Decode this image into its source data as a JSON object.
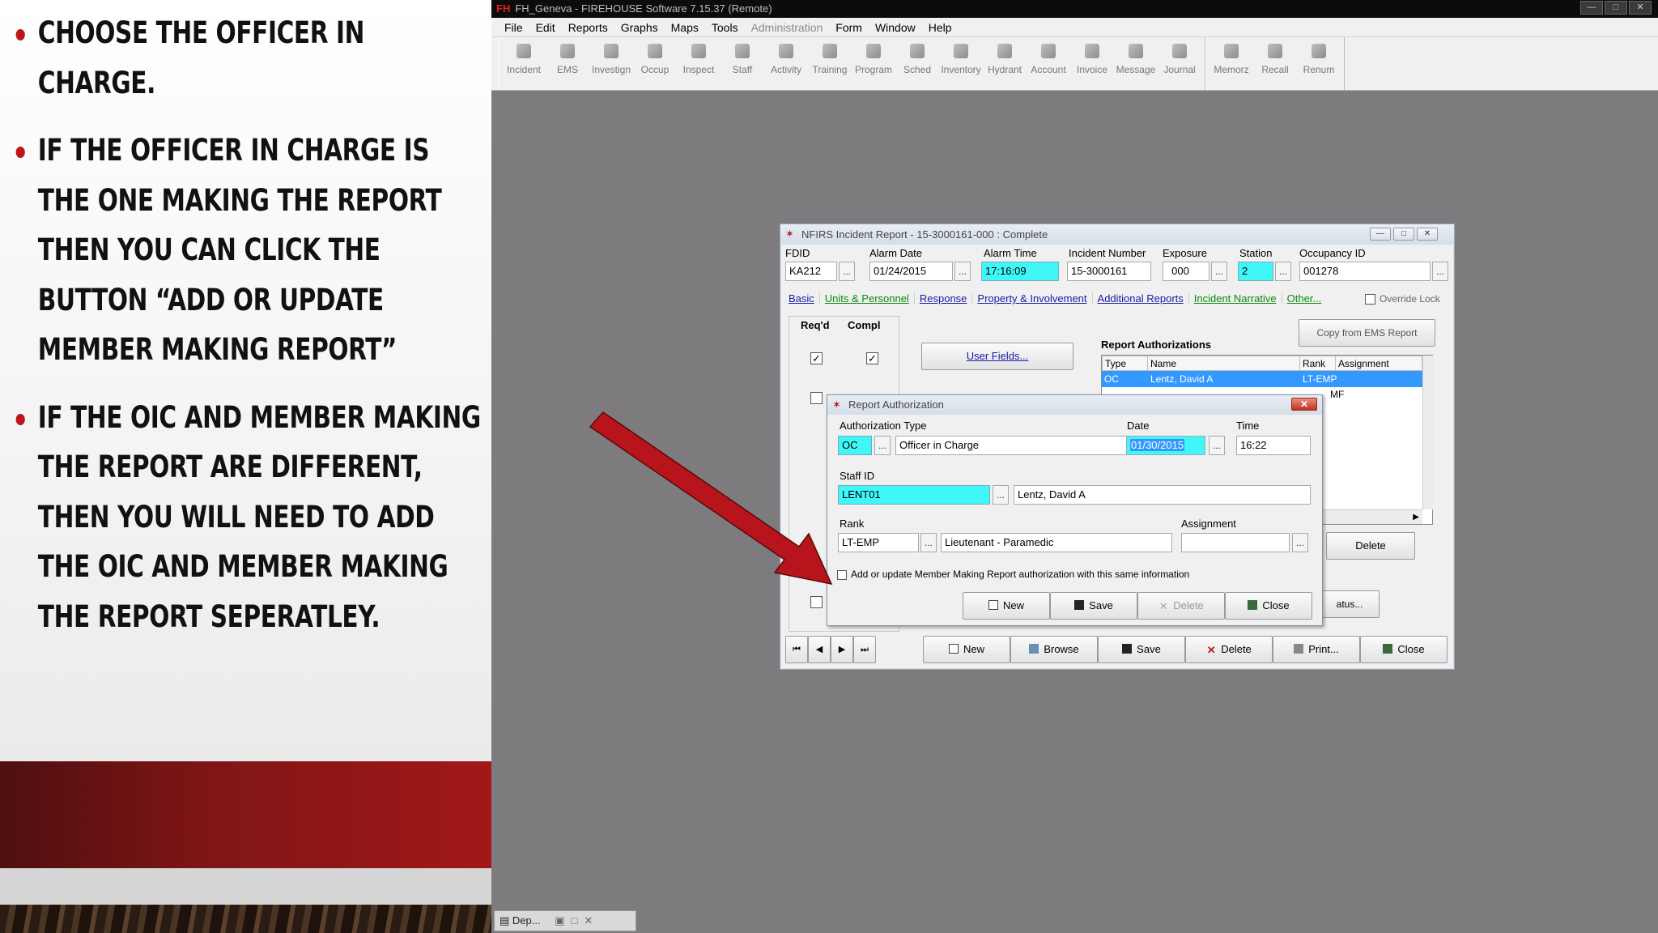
{
  "slide": {
    "bullets": [
      "Choose the officer in charge.",
      "If the officer in charge is the one making the report then you can click the button “add or update member making report”",
      "If the OIC and member making the report are different, then you will need to add the OIC and member making the report seperatley."
    ],
    "colors": {
      "accent": "#c0141b",
      "band": "#a31818"
    }
  },
  "app": {
    "title": "FH_Geneva - FIREHOUSE Software 7.15.37 (Remote)",
    "logo_text": "FH",
    "menu": [
      "File",
      "Edit",
      "Reports",
      "Graphs",
      "Maps",
      "Tools",
      "Administration",
      "Form",
      "Window",
      "Help"
    ],
    "toolbar_group1": [
      "Incident",
      "EMS",
      "Investign",
      "Occup",
      "Inspect",
      "Staff",
      "Activity",
      "Training",
      "Program",
      "Sched",
      "Inventory",
      "Hydrant",
      "Account",
      "Invoice",
      "Message",
      "Journal"
    ],
    "toolbar_group2": [
      "Memorz",
      "Recall",
      "Renum"
    ],
    "taskbar_item": "Dep..."
  },
  "nfirs": {
    "title": "NFIRS Incident Report  - 15-3000161-000   : Complete",
    "labels": {
      "fdid": "FDID",
      "alarm_date": "Alarm Date",
      "alarm_time": "Alarm Time",
      "incident_number": "Incident Number",
      "exposure": "Exposure",
      "station": "Station",
      "occupancy_id": "Occupancy ID"
    },
    "values": {
      "fdid": "KA212",
      "alarm_date": "01/24/2015",
      "alarm_time": "17:16:09",
      "incident_number": "15-3000161",
      "exposure": "000",
      "station": "2",
      "occupancy_id": "001278"
    },
    "override_lock": "Override Lock",
    "tabs": [
      "Basic",
      "Units & Personnel",
      "Response",
      "Property & Involvement",
      "Additional Reports",
      "Incident Narrative",
      "Other..."
    ],
    "reqd_header": "Req'd",
    "compl_header": "Compl",
    "user_fields_btn": "User Fields...",
    "copy_ems_btn": "Copy from EMS Report",
    "report_auth_title": "Report Authorizations",
    "grid_headers": [
      "Type",
      "Name",
      "Rank",
      "Assignment"
    ],
    "grid_row": [
      "OC",
      "Lentz, David A",
      "LT-EMP",
      ""
    ],
    "grid_partial": "MF",
    "delete_btn": "Delete",
    "status_btn": "atus...",
    "bottom_buttons": [
      "New",
      "Browse",
      "Save",
      "Delete",
      "Print...",
      "Close"
    ]
  },
  "dialog": {
    "title": "Report Authorization",
    "auth_type_label": "Authorization Type",
    "auth_type_code": "OC",
    "auth_type_desc": "Officer in Charge",
    "date_label": "Date",
    "date_value": "01/30/2015",
    "time_label": "Time",
    "time_value": "16:22",
    "staff_label": "Staff ID",
    "staff_id": "LENT01",
    "staff_name": "Lentz, David A",
    "rank_label": "Rank",
    "rank_code": "LT-EMP",
    "rank_desc": "Lieutenant - Paramedic",
    "assignment_label": "Assignment",
    "assignment_value": "",
    "checkbox_label": "Add or update Member Making Report authorization with this same information",
    "buttons": [
      "New",
      "Save",
      "Delete",
      "Close"
    ]
  }
}
